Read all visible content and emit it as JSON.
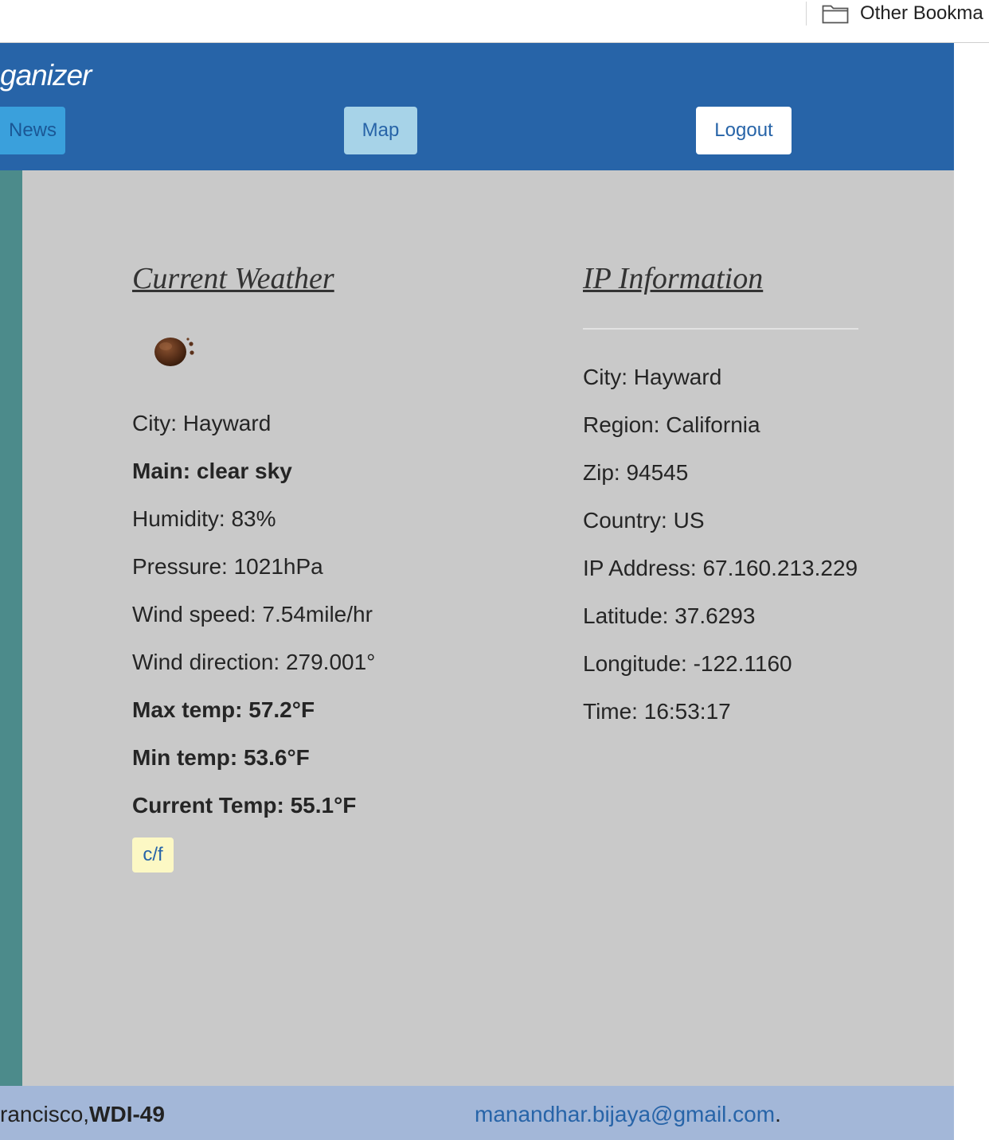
{
  "bookmarks_bar": {
    "other_bookmarks_label": "Other Bookma"
  },
  "navbar": {
    "brand": "ganizer",
    "buttons": {
      "news": "News",
      "map": "Map",
      "logout": "Logout"
    }
  },
  "weather": {
    "title": "Current Weather",
    "icon": "weather-icon",
    "city": "City: Hayward",
    "main": "Main: clear sky",
    "humidity": "Humidity: 83%",
    "pressure": "Pressure: 1021hPa",
    "wind_speed": "Wind speed: 7.54mile/hr",
    "wind_direction": "Wind direction: 279.001°",
    "max_temp": "Max temp: 57.2°F",
    "min_temp": "Min temp: 53.6°F",
    "current_temp": "Current Temp: 55.1°F",
    "toggle_label": "c/f"
  },
  "ip_info": {
    "title": "IP Information",
    "city": "City: Hayward",
    "region": "Region: California",
    "zip": "Zip: 94545",
    "country": "Country: US",
    "ip_address": "IP Address: 67.160.213.229",
    "latitude": "Latitude: 37.6293",
    "longitude": "Longitude: -122.1160",
    "time": "Time: 16:53:17"
  },
  "footer": {
    "location": "rancisco,",
    "course": "WDI-49",
    "email": "manandhar.bijaya@gmail.com",
    "trailing": "."
  },
  "colors": {
    "navbar": "#2764a8",
    "main_bg": "#c9c9c9",
    "side_bar": "#4c8b8b",
    "footer_bg": "#a3b7d8",
    "toggle_bg": "#fcf8c4"
  }
}
